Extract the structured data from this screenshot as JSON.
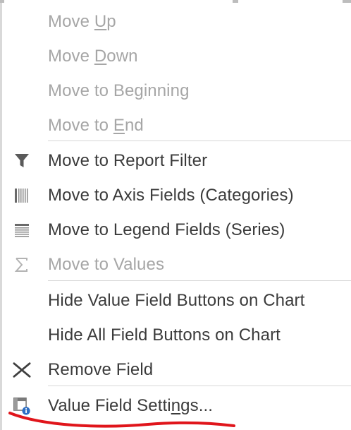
{
  "menu": {
    "items": [
      {
        "pre": "Move ",
        "ul": "U",
        "post": "p",
        "disabled": true,
        "icon": ""
      },
      {
        "pre": "Move ",
        "ul": "D",
        "post": "own",
        "disabled": true,
        "icon": ""
      },
      {
        "pre": "Move to Be",
        "ul": "g",
        "post": "inning",
        "disabled": true,
        "icon": ""
      },
      {
        "pre": "Move to ",
        "ul": "E",
        "post": "nd",
        "disabled": true,
        "icon": ""
      },
      {
        "pre": "Move to Report Filter",
        "ul": "",
        "post": "",
        "disabled": false,
        "icon": "filter-icon"
      },
      {
        "pre": "Move to Axis Fields (Categories)",
        "ul": "",
        "post": "",
        "disabled": false,
        "icon": "axis-fields-icon"
      },
      {
        "pre": "Move to Legend Fields (Series)",
        "ul": "",
        "post": "",
        "disabled": false,
        "icon": "legend-fields-icon"
      },
      {
        "pre": "Move to Values",
        "ul": "",
        "post": "",
        "disabled": true,
        "icon": "sigma-icon"
      },
      {
        "pre": "Hide Value Field Buttons on Chart",
        "ul": "",
        "post": "",
        "disabled": false,
        "icon": ""
      },
      {
        "pre": "Hide All Field Buttons on Chart",
        "ul": "",
        "post": "",
        "disabled": false,
        "icon": ""
      },
      {
        "pre": "Remove Field",
        "ul": "",
        "post": "",
        "disabled": false,
        "icon": "remove-x-icon"
      },
      {
        "pre": "Value Field Setti",
        "ul": "n",
        "post": "gs...",
        "disabled": false,
        "icon": "field-settings-icon"
      }
    ]
  },
  "colors": {
    "text": "#3b3b3b",
    "disabled_text": "#a6a6a6",
    "separator": "#d6d6d6",
    "annotation": "#e0151b",
    "info_badge": "#2e6fc4"
  }
}
